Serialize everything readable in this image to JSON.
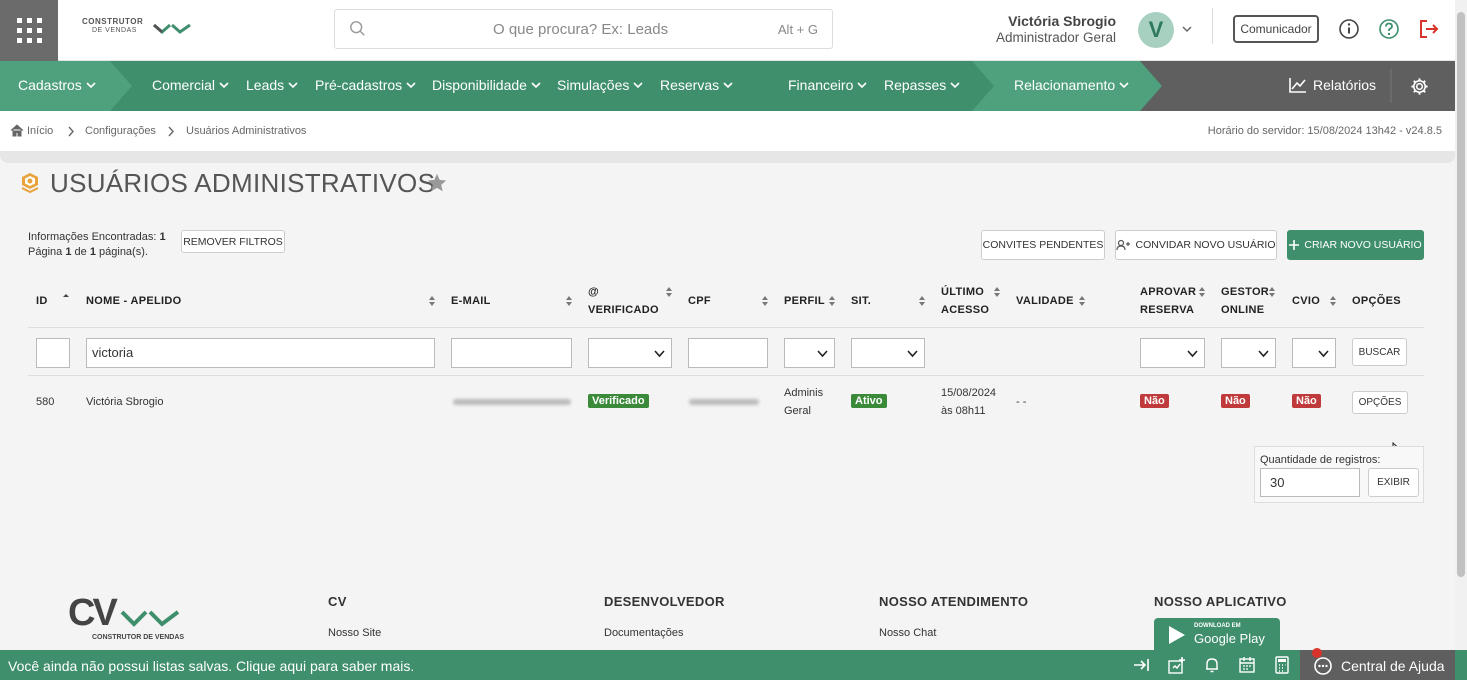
{
  "header": {
    "logo_line1": "CONSTRUTOR",
    "logo_line2": "DE VENDAS",
    "search_placeholder": "O que procura? Ex: Leads",
    "search_shortcut": "Alt + G",
    "user_name": "Victória Sbrogio",
    "user_role": "Administrador Geral",
    "avatar_letter": "V",
    "communicator_label": "Comunicador"
  },
  "nav": {
    "items": [
      "Cadastros",
      "Comercial",
      "Leads",
      "Pré-cadastros",
      "Disponibilidade",
      "Simulações",
      "Reservas",
      "Financeiro",
      "Repasses",
      "Relacionamento"
    ],
    "reports": "Relatórios"
  },
  "breadcrumb": {
    "home": "Início",
    "config": "Configurações",
    "current": "Usuários Administrativos",
    "server_time": "Horário do servidor: 15/08/2024 13h42 - v24.8.5"
  },
  "page": {
    "title": "USUÁRIOS ADMINISTRATIVOS",
    "found_label": "Informações Encontradas:",
    "found_count": "1",
    "page_word": "Página",
    "page_current": "1",
    "page_of": "de",
    "page_total": "1",
    "page_suffix": "página(s).",
    "remove_filters": "REMOVER FILTROS",
    "pending_invites": "CONVITES PENDENTES",
    "invite_user": "CONVIDAR NOVO USUÁRIO",
    "create_user": "CRIAR NOVO USUÁRIO"
  },
  "table": {
    "headers": {
      "id": "ID",
      "name": "NOME - APELIDO",
      "email": "E-MAIL",
      "verified_1": "@",
      "verified_2": "VERIFICADO",
      "cpf": "CPF",
      "profile": "PERFIL",
      "status": "SIT.",
      "last_access_1": "ÚLTIMO",
      "last_access_2": "ACESSO",
      "validity": "VALIDADE",
      "approve_1": "APROVAR",
      "approve_2": "RESERVA",
      "manager_1": "GESTOR",
      "manager_2": "ONLINE",
      "cvio": "CVIO",
      "options": "OPÇÕES"
    },
    "filters": {
      "name_value": "victoria",
      "search_button": "BUSCAR"
    },
    "row": {
      "id": "580",
      "name": "Victória Sbrogio",
      "verified": "Verificado",
      "profile_1": "Adminis",
      "profile_2": "Geral",
      "status": "Ativo",
      "last_access_1": "15/08/2024",
      "last_access_2": "às 08h11",
      "validity": "- -",
      "approve": "Não",
      "manager": "Não",
      "cvio": "Não",
      "options_button": "OPÇÕES"
    }
  },
  "records": {
    "label": "Quantidade de registros:",
    "value": "30",
    "show_button": "EXIBIR"
  },
  "footer": {
    "col1_title": "CV",
    "col1_link": "Nosso Site",
    "col2_title": "DESENVOLVEDOR",
    "col2_link": "Documentações",
    "col3_title": "NOSSO ATENDIMENTO",
    "col3_link": "Nosso Chat",
    "col4_title": "NOSSO APLICATIVO",
    "gplay_small": "DOWNLOAD EM",
    "gplay_big": "Google Play",
    "logo_caption": "CONSTRUTOR DE VENDAS"
  },
  "bottom": {
    "message": "Você ainda não possui listas salvas. Clique aqui para saber mais.",
    "help": "Central de Ajuda"
  },
  "colors": {
    "brand_green": "#3f8f6d",
    "nav_dark": "#5f5f5f",
    "badge_red": "#c0393b",
    "badge_green": "#3a8a3a"
  }
}
